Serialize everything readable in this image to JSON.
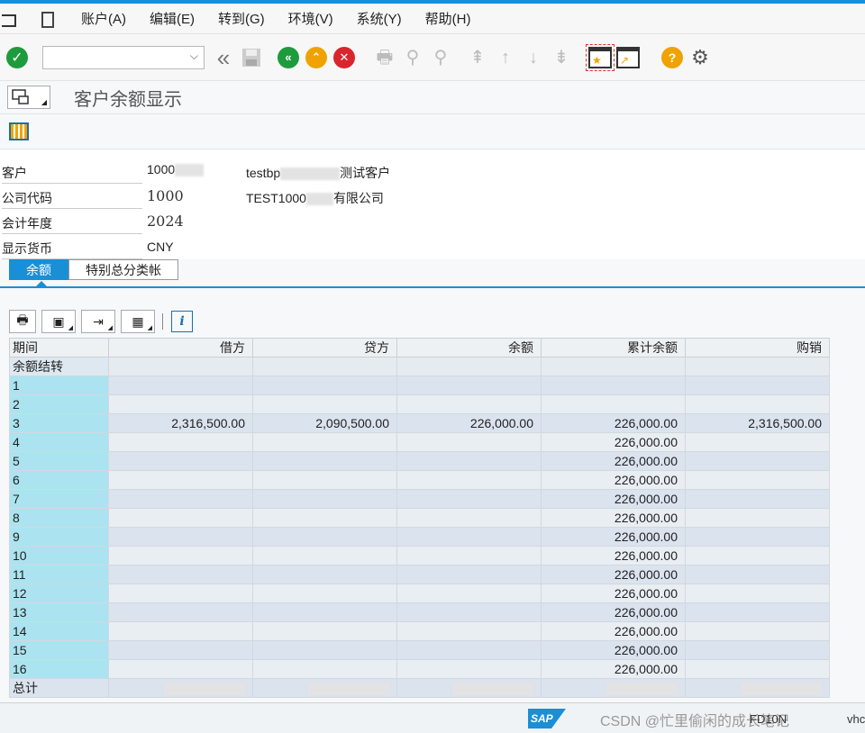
{
  "menu": [
    "账户(A)",
    "编辑(E)",
    "转到(G)",
    "环境(V)",
    "系统(Y)",
    "帮助(H)"
  ],
  "page_title": "客户余额显示",
  "header": {
    "customer_label": "客户",
    "customer_value": "1000",
    "customer_name_prefix": "testbp",
    "customer_name_suffix": "测试客户",
    "company_label": "公司代码",
    "company_value": "1000",
    "company_name_prefix": "TEST1000",
    "company_name_suffix": "有限公司",
    "year_label": "会计年度",
    "year_value": "2024",
    "currency_label": "显示货币",
    "currency_value": "CNY"
  },
  "tabs": [
    "余额",
    "特别总分类帐"
  ],
  "table": {
    "columns": [
      "期间",
      "借方",
      "贷方",
      "余额",
      "累计余额",
      "购销"
    ],
    "rows": [
      [
        "余额结转",
        "",
        "",
        "",
        "",
        ""
      ],
      [
        "1",
        "",
        "",
        "",
        "",
        ""
      ],
      [
        "2",
        "",
        "",
        "",
        "",
        ""
      ],
      [
        "3",
        "2,316,500.00",
        "2,090,500.00",
        "226,000.00",
        "226,000.00",
        "2,316,500.00"
      ],
      [
        "4",
        "",
        "",
        "",
        "226,000.00",
        ""
      ],
      [
        "5",
        "",
        "",
        "",
        "226,000.00",
        ""
      ],
      [
        "6",
        "",
        "",
        "",
        "226,000.00",
        ""
      ],
      [
        "7",
        "",
        "",
        "",
        "226,000.00",
        ""
      ],
      [
        "8",
        "",
        "",
        "",
        "226,000.00",
        ""
      ],
      [
        "9",
        "",
        "",
        "",
        "226,000.00",
        ""
      ],
      [
        "10",
        "",
        "",
        "",
        "226,000.00",
        ""
      ],
      [
        "11",
        "",
        "",
        "",
        "226,000.00",
        ""
      ],
      [
        "12",
        "",
        "",
        "",
        "226,000.00",
        ""
      ],
      [
        "13",
        "",
        "",
        "",
        "226,000.00",
        ""
      ],
      [
        "14",
        "",
        "",
        "",
        "226,000.00",
        ""
      ],
      [
        "15",
        "",
        "",
        "",
        "226,000.00",
        ""
      ],
      [
        "16",
        "",
        "",
        "",
        "226,000.00",
        ""
      ]
    ],
    "total_label": "总计"
  },
  "footer": {
    "watermark": "CSDN @忙里偷闲的成长笔记",
    "tcode": "FD10N",
    "user": "vhc"
  }
}
